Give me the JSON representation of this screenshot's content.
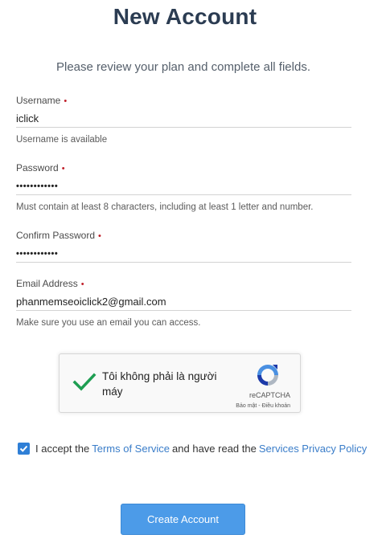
{
  "page": {
    "title": "New Account",
    "subtitle": "Please review your plan and complete all fields."
  },
  "form": {
    "username": {
      "label": "Username",
      "value": "iclick",
      "hint": "Username is available"
    },
    "password": {
      "label": "Password",
      "value": "••••••••••••",
      "hint": "Must contain at least 8 characters, including at least 1 letter and number."
    },
    "confirm_password": {
      "label": "Confirm Password",
      "value": "••••••••••••"
    },
    "email": {
      "label": "Email Address",
      "value": "phanmemseoiclick2@gmail.com",
      "hint": "Make sure you use an email you can access."
    },
    "required_marker": "•"
  },
  "captcha": {
    "checked": true,
    "text": "Tôi không phải là người máy",
    "brand": "reCAPTCHA",
    "links": "Bảo mật - Điều khoản",
    "check_color": "#1e9e52"
  },
  "terms": {
    "checked": true,
    "prefix": "I accept the",
    "tos_link": "Terms of Service",
    "middle": "and have read the",
    "privacy_link": "Services Privacy Policy"
  },
  "actions": {
    "create_label": "Create Account"
  },
  "colors": {
    "accent": "#4c9be8",
    "link": "#3a7dc9",
    "title": "#2b3c52",
    "required": "#c0202a"
  }
}
